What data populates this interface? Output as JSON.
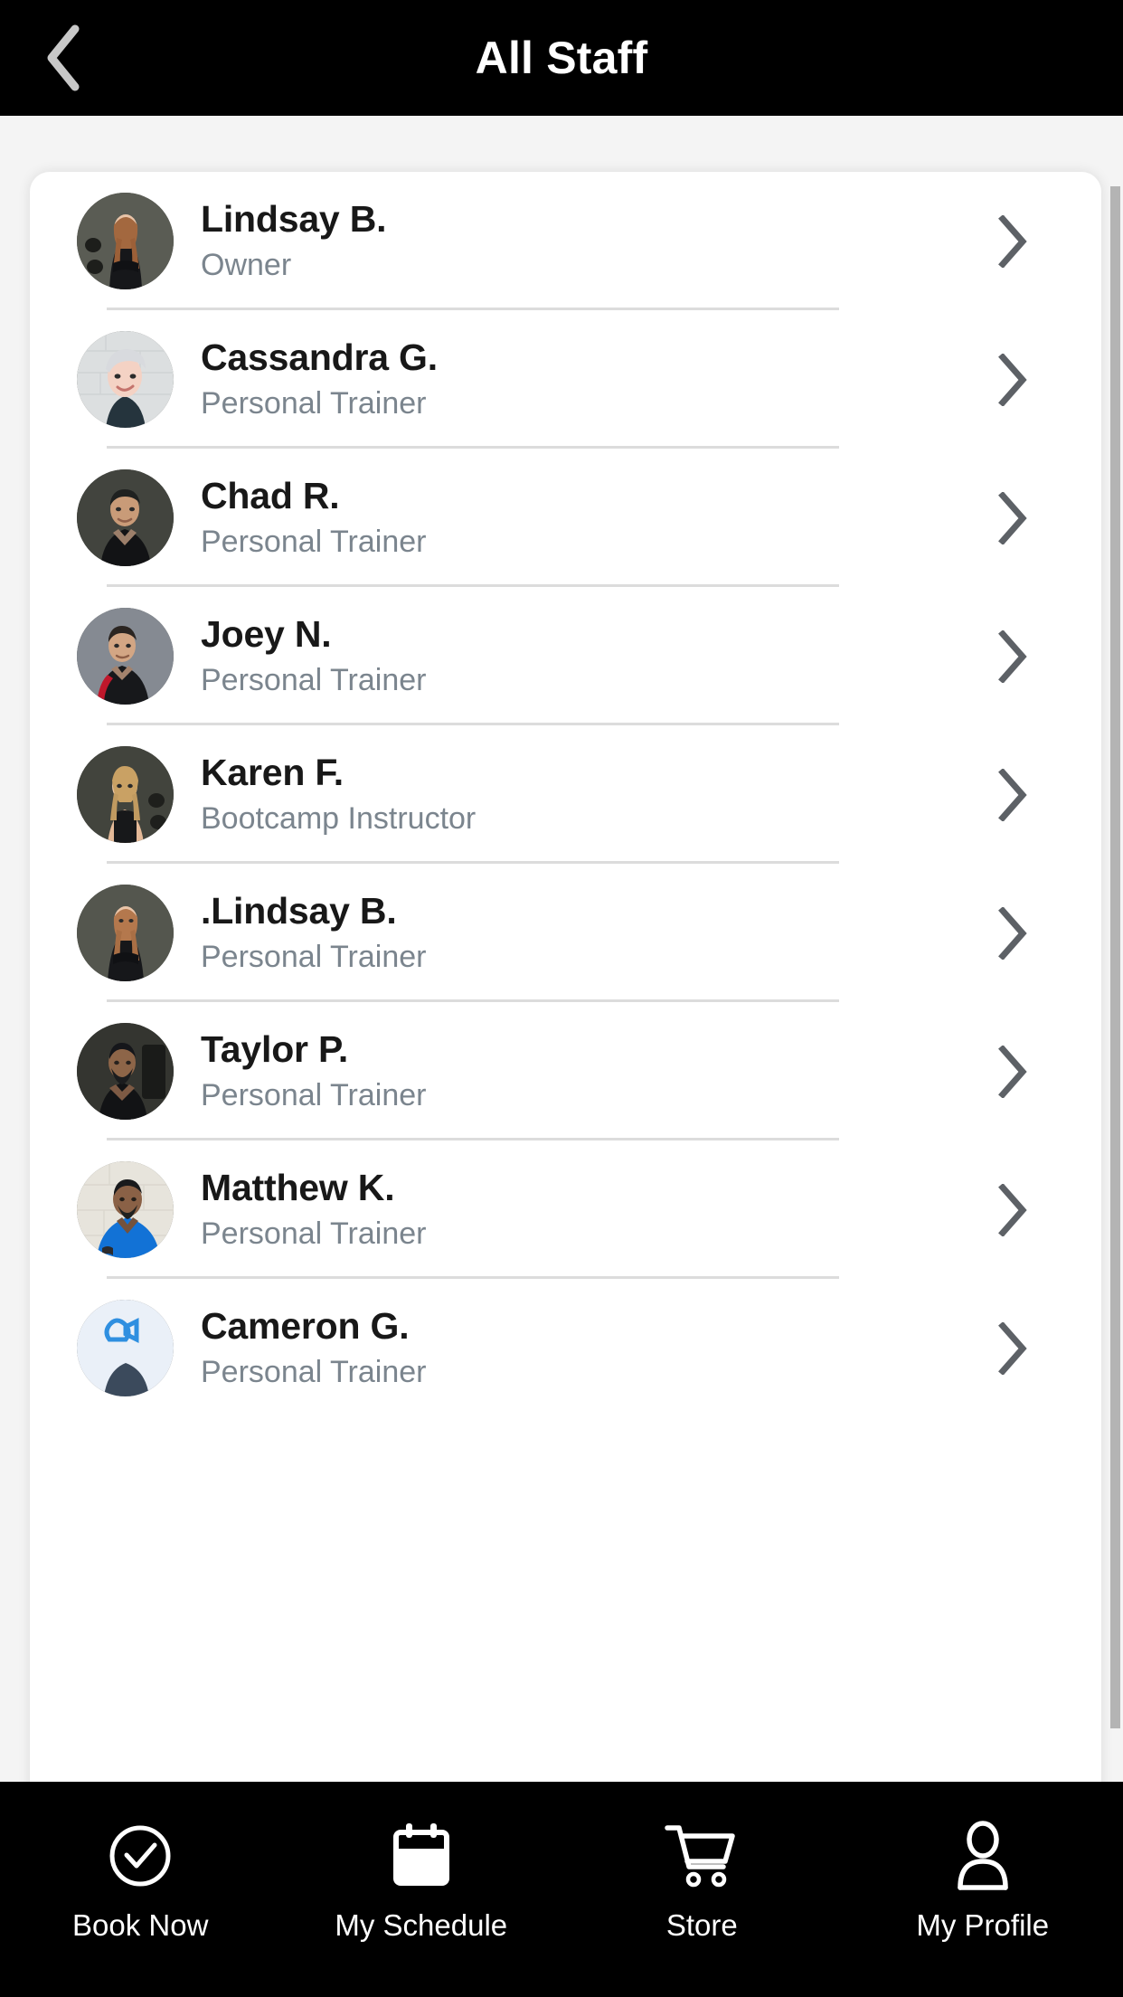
{
  "header": {
    "title": "All Staff",
    "back_icon": "chevron-left-icon",
    "background": "#000000",
    "title_color": "#ffffff"
  },
  "theme": {
    "page_background": "#f4f4f4",
    "card_background": "#ffffff",
    "separator": "#dcdcdc",
    "name_color": "#181818",
    "role_color": "#7b858e",
    "chevron_color": "#5d6166",
    "scrollbar_color": "#b4b4b4"
  },
  "staff_list": {
    "row_chevron_icon": "chevron-right-icon",
    "items": [
      {
        "name": "Lindsay B.",
        "role": "Owner",
        "avatar": "avatar-lindsay-b",
        "avatar_bg": "#4d4f49",
        "avatar_tone": "dark"
      },
      {
        "name": "Cassandra G.",
        "role": "Personal Trainer",
        "avatar": "avatar-cassandra-g",
        "avatar_bg": "#d9dcdd",
        "avatar_tone": "light"
      },
      {
        "name": "Chad R.",
        "role": "Personal Trainer",
        "avatar": "avatar-chad-r",
        "avatar_bg": "#3b3c38",
        "avatar_tone": "dark"
      },
      {
        "name": "Joey N.",
        "role": "Personal Trainer",
        "avatar": "avatar-joey-n",
        "avatar_bg": "#7b8087",
        "avatar_tone": "dark"
      },
      {
        "name": "Karen F.",
        "role": "Bootcamp Instructor",
        "avatar": "avatar-karen-f",
        "avatar_bg": "#3c3d38",
        "avatar_tone": "dark"
      },
      {
        "name": ".Lindsay B.",
        "role": "Personal Trainer",
        "avatar": "avatar-dot-lindsay-b",
        "avatar_bg": "#4d4f49",
        "avatar_tone": "dark"
      },
      {
        "name": "Taylor P.",
        "role": "Personal Trainer",
        "avatar": "avatar-taylor-p",
        "avatar_bg": "#2e2f2c",
        "avatar_tone": "dark"
      },
      {
        "name": "Matthew K.",
        "role": "Personal Trainer",
        "avatar": "avatar-matthew-k",
        "avatar_bg": "#e4e2da",
        "avatar_tone": "light"
      },
      {
        "name": "Cameron G.",
        "role": "Personal Trainer",
        "avatar": "avatar-cameron-g",
        "avatar_bg": "#e8eef7",
        "avatar_tone": "light"
      }
    ]
  },
  "tabbar": {
    "background": "#000000",
    "label_color": "#ffffff",
    "items": [
      {
        "label": "Book Now",
        "icon": "check-circle-icon"
      },
      {
        "label": "My Schedule",
        "icon": "calendar-icon"
      },
      {
        "label": "Store",
        "icon": "shopping-cart-icon"
      },
      {
        "label": "My Profile",
        "icon": "person-icon"
      }
    ]
  }
}
